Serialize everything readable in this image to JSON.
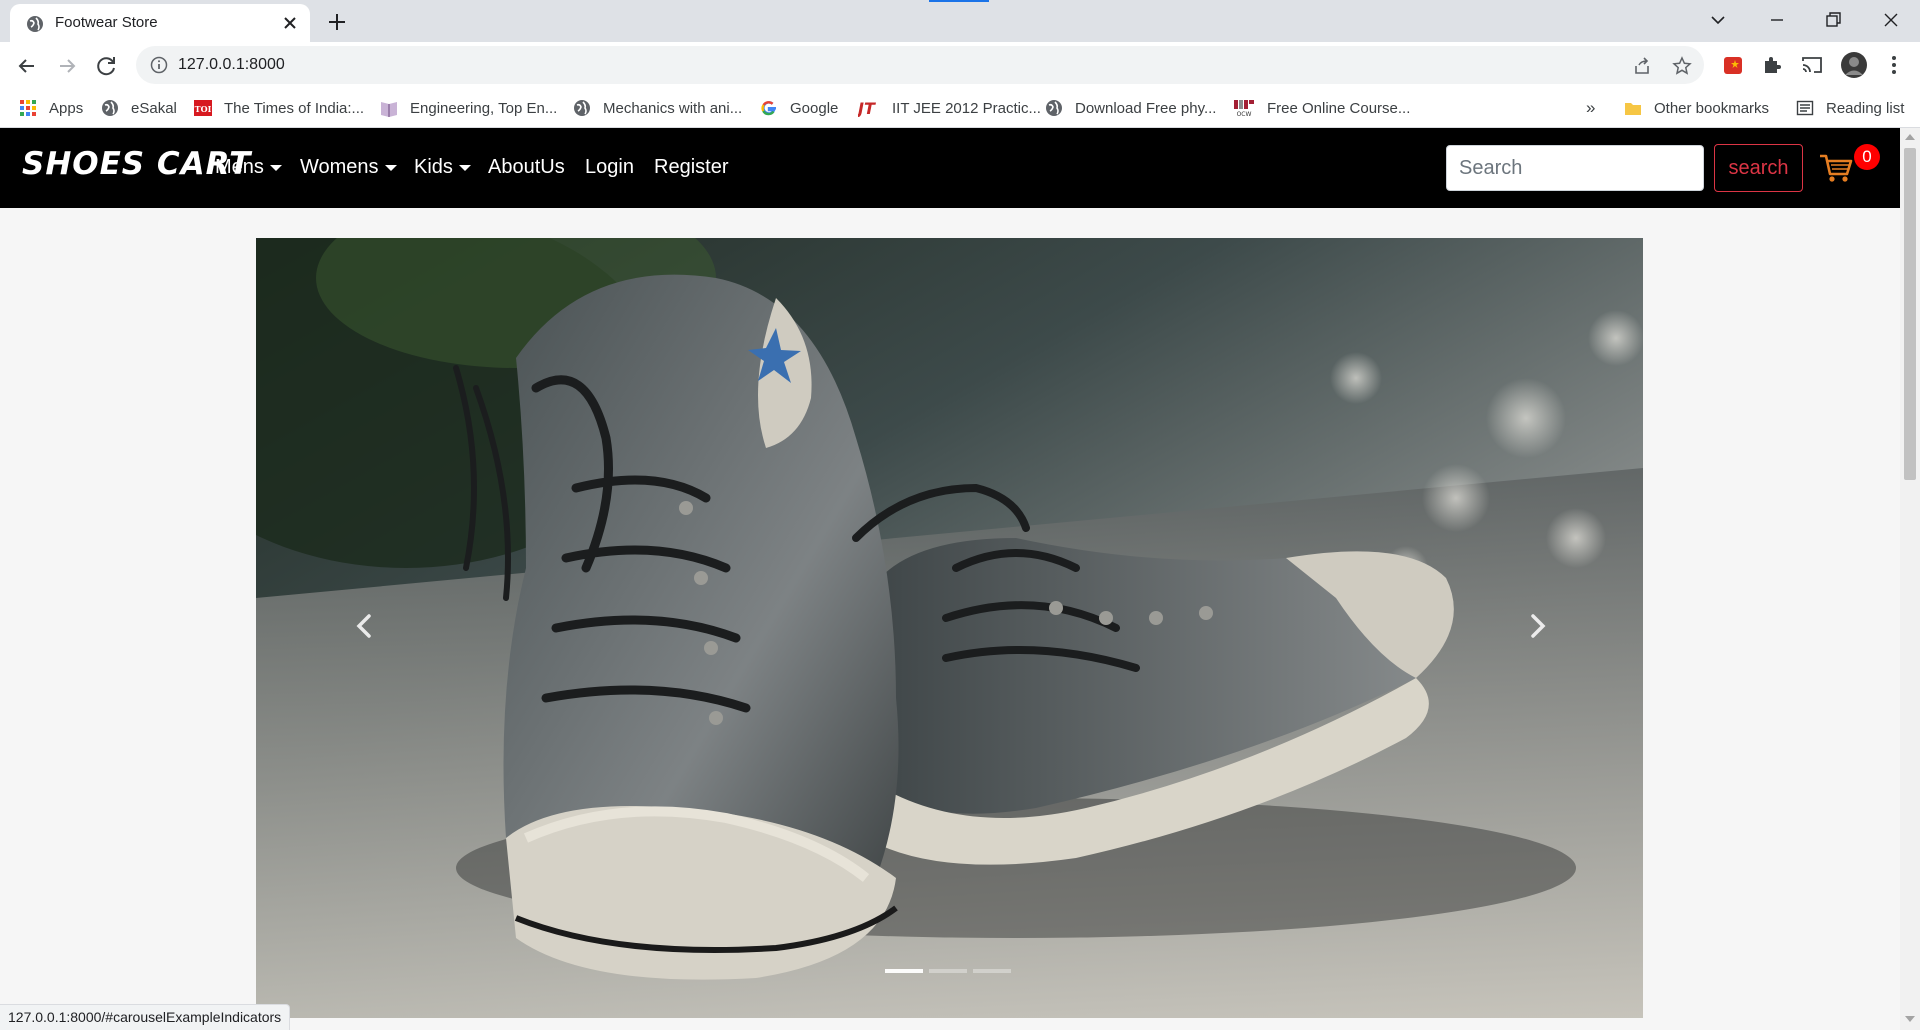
{
  "browser": {
    "tab_title": "Footwear Store",
    "url": "127.0.0.1:8000",
    "status_url": "127.0.0.1:8000/#carouselExampleIndicators"
  },
  "bookmarks": {
    "items": [
      {
        "label": "Apps",
        "icon": "apps-grid-icon"
      },
      {
        "label": "eSakal",
        "icon": "globe-icon"
      },
      {
        "label": "The Times of India:...",
        "icon": "toi-icon"
      },
      {
        "label": "Engineering, Top En...",
        "icon": "book-icon"
      },
      {
        "label": "Mechanics with ani...",
        "icon": "globe-icon"
      },
      {
        "label": "Google",
        "icon": "google-icon"
      },
      {
        "label": "IIT JEE 2012 Practic...",
        "icon": "jt-icon"
      },
      {
        "label": "Download Free phy...",
        "icon": "globe-icon"
      },
      {
        "label": "Free Online Course...",
        "icon": "mit-icon"
      }
    ],
    "overflow": "»",
    "other": "Other bookmarks",
    "reading_list": "Reading list"
  },
  "site": {
    "brand": "SHOES CART",
    "nav": [
      {
        "label": "Mens",
        "dropdown": true
      },
      {
        "label": "Womens",
        "dropdown": true
      },
      {
        "label": "Kids",
        "dropdown": true
      },
      {
        "label": "AboutUs",
        "dropdown": false
      },
      {
        "label": "Login",
        "dropdown": false
      },
      {
        "label": "Register",
        "dropdown": false
      }
    ],
    "search_placeholder": "Search",
    "search_button": "search",
    "cart_count": "0"
  },
  "carousel": {
    "slide_count": 3,
    "active_index": 0
  },
  "colors": {
    "navbar_bg": "#000000",
    "accent_red": "#dc3545",
    "badge_red": "#ff0000",
    "cart_orange": "#e67e22"
  }
}
